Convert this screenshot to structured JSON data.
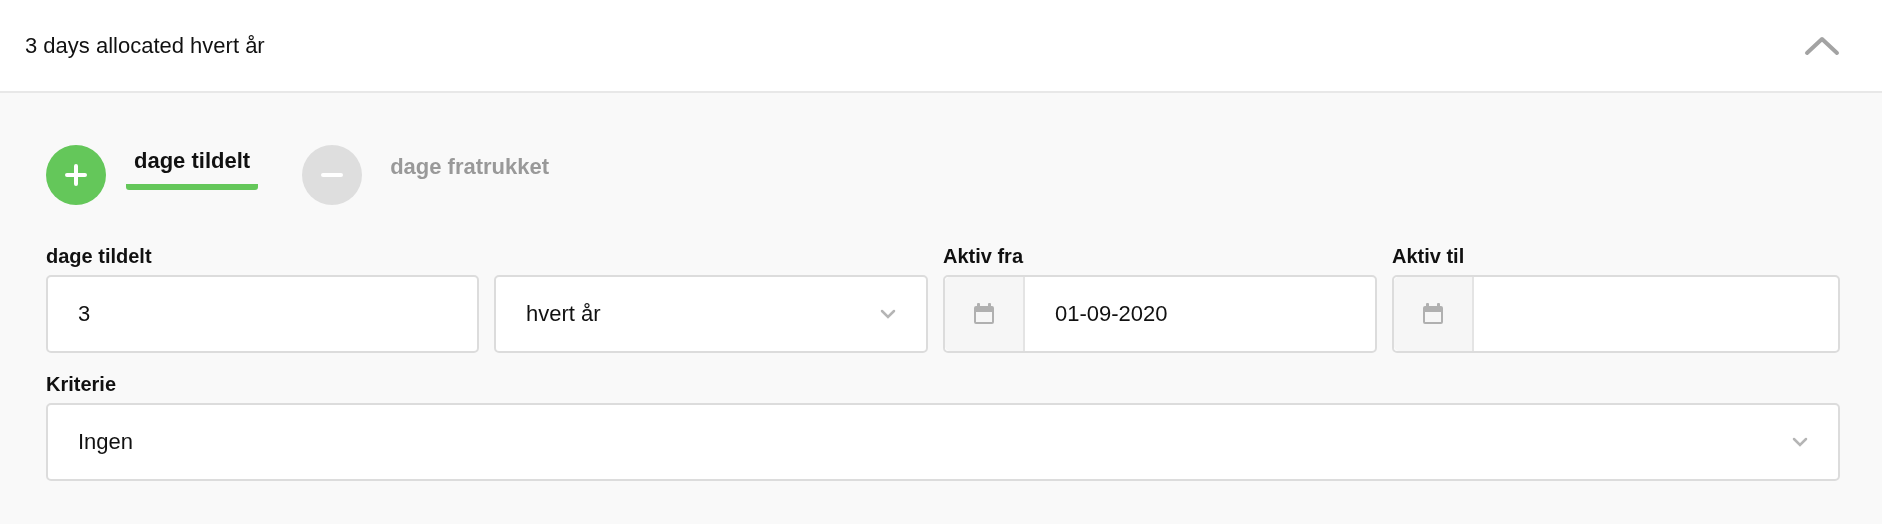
{
  "header": {
    "title": "3 days allocated hvert år",
    "expanded": true
  },
  "mode_tabs": [
    {
      "kind": "add",
      "label": "dage tildelt",
      "selected": true
    },
    {
      "kind": "subtract",
      "label": "dage fratrukket",
      "selected": false
    }
  ],
  "fields": [
    {
      "kind": "text",
      "label": "dage tildelt",
      "value": "3"
    },
    {
      "kind": "select",
      "value": "hvert år"
    },
    {
      "kind": "date",
      "label": "Aktiv fra",
      "value": "01-09-2020"
    },
    {
      "kind": "date",
      "label": "Aktiv til"
    }
  ],
  "criterion": {
    "label": "Kriterie",
    "value": "Ingen"
  }
}
